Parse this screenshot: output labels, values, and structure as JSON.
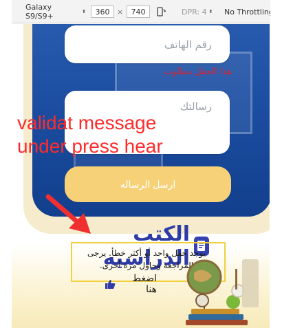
{
  "devtools": {
    "device": "Galaxy S9/S9+",
    "width": "360",
    "times": "×",
    "height": "740",
    "dpr": "DPR: 4",
    "throttling": "No Throttling"
  },
  "form": {
    "phone_placeholder": "رقم الهاتف",
    "phone_error": "هذا الحقل مطلوب",
    "message_placeholder": "رسالتك",
    "send_label": "ارسل الرساله"
  },
  "annotation": {
    "line1": "validat message",
    "line2": "under press hear"
  },
  "brand": {
    "name": "الكتب الدراسيه"
  },
  "notice": {
    "line1": "يوجد حقل واحد أو أكثر خطأ. يرجى",
    "line2": "المراجعة وحاول مرة أخرى.",
    "press_label": "اضغط هنا"
  },
  "colors": {
    "accent_blue": "#1d4fa3",
    "button_yellow": "#f6d177",
    "error_red": "#e0202a",
    "annotation_red": "#ff2b2b",
    "highlight": "#f2d13b"
  },
  "icons": {
    "rotate": "rotate-device-icon",
    "book": "book-icon",
    "thumb": "thumbs-up-icon",
    "arrow": "red-arrow-icon"
  }
}
